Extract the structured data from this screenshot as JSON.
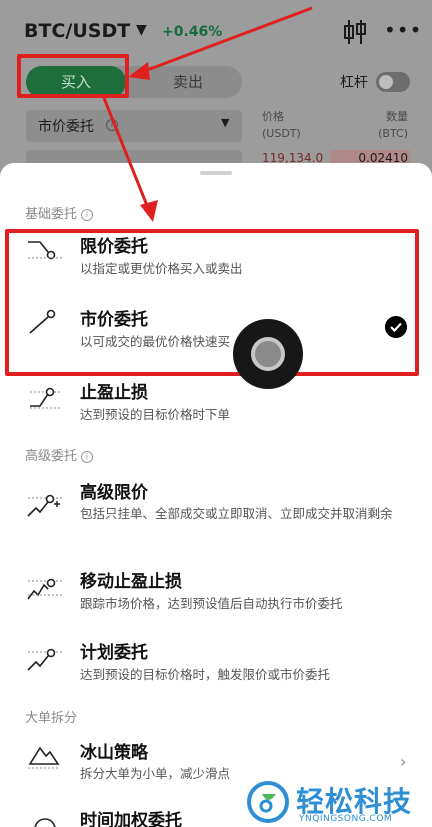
{
  "header": {
    "pair": "BTC/USDT",
    "change": "+0.46%",
    "candle_icon": "candlestick-icon",
    "more_icon": "more-dots-icon"
  },
  "trade_form": {
    "buy_label": "买入",
    "sell_label": "卖出",
    "leverage_label": "杠杆",
    "leverage_on": false,
    "order_type": "市价委托",
    "price_header": [
      "价格",
      "(USDT)"
    ],
    "qty_header": [
      "数量",
      "(BTC)"
    ],
    "ask_price": "119,134.0",
    "ask_qty": "0.02410"
  },
  "sheet": {
    "sections": [
      {
        "title": "基础委托",
        "items": [
          {
            "title": "限价委托",
            "desc": "以指定或更优价格买入或卖出",
            "icon": "limit-order-icon"
          },
          {
            "title": "市价委托",
            "desc": "以可成交的最优价格快速买",
            "icon": "market-order-icon",
            "selected": true
          },
          {
            "title": "止盈止损",
            "desc": "达到预设的目标价格时下单",
            "icon": "tp-sl-icon"
          }
        ]
      },
      {
        "title": "高级委托",
        "items": [
          {
            "title": "高级限价",
            "desc": "包括只挂单、全部成交或立即取消、立即成交并取消剩余",
            "icon": "advanced-limit-icon"
          },
          {
            "title": "移动止盈止损",
            "desc": "跟踪市场价格，达到预设值后自动执行市价委托",
            "icon": "trailing-stop-icon"
          },
          {
            "title": "计划委托",
            "desc": "达到预设的目标价格时，触发限价或市价委托",
            "icon": "trigger-order-icon"
          }
        ]
      },
      {
        "title": "大单拆分",
        "items": [
          {
            "title": "冰山策略",
            "desc": "拆分大单为小单，减少滑点",
            "icon": "iceberg-icon"
          },
          {
            "title": "时间加权委托",
            "desc": "",
            "icon": "twap-icon"
          }
        ]
      }
    ]
  },
  "watermark": {
    "text": "轻松科技",
    "sub": "YNQINGSONG.COM"
  },
  "colors": {
    "annotation_red": "#e0201f",
    "buy_green": "#1e6e3c",
    "watermark_blue": "#2e8fd4"
  }
}
